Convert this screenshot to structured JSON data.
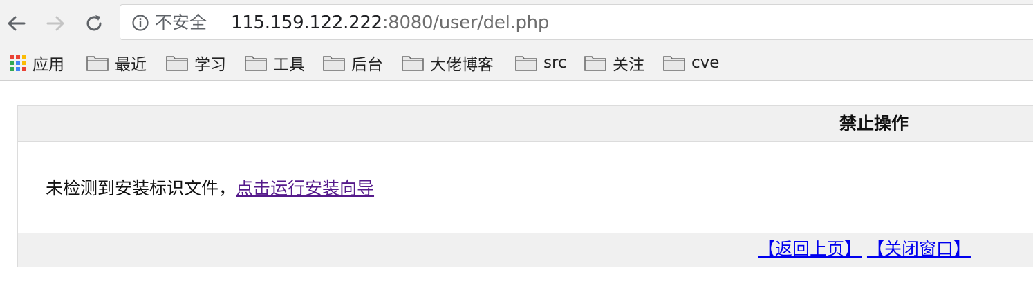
{
  "browser": {
    "security_label": "不安全",
    "url_host": "115.159.122.222",
    "url_rest": ":8080/user/del.php",
    "icons": {
      "back": "arrow-left-icon",
      "forward": "arrow-right-icon",
      "reload": "reload-icon",
      "info": "info-circle-icon"
    }
  },
  "bookmarks": {
    "apps_label": "应用",
    "items": [
      {
        "label": "最近",
        "icon": "folder-icon"
      },
      {
        "label": "学习",
        "icon": "folder-icon"
      },
      {
        "label": "工具",
        "icon": "folder-icon"
      },
      {
        "label": "后台",
        "icon": "folder-icon"
      },
      {
        "label": "大佬博客",
        "icon": "folder-icon"
      },
      {
        "label": "src",
        "icon": "folder-icon"
      },
      {
        "label": "关注",
        "icon": "folder-icon"
      },
      {
        "label": "cve",
        "icon": "folder-icon"
      }
    ]
  },
  "page": {
    "title": "禁止操作",
    "message_prefix": "未检测到安装标识文件，",
    "message_link": "点击运行安装向导",
    "back_link": "【返回上页】",
    "close_link": "【关闭窗口】"
  },
  "colors": {
    "visited_link": "#551a8b",
    "link": "#0000ee",
    "panel_bg": "#f0f0f0",
    "panel_border": "#dcdcdc"
  }
}
